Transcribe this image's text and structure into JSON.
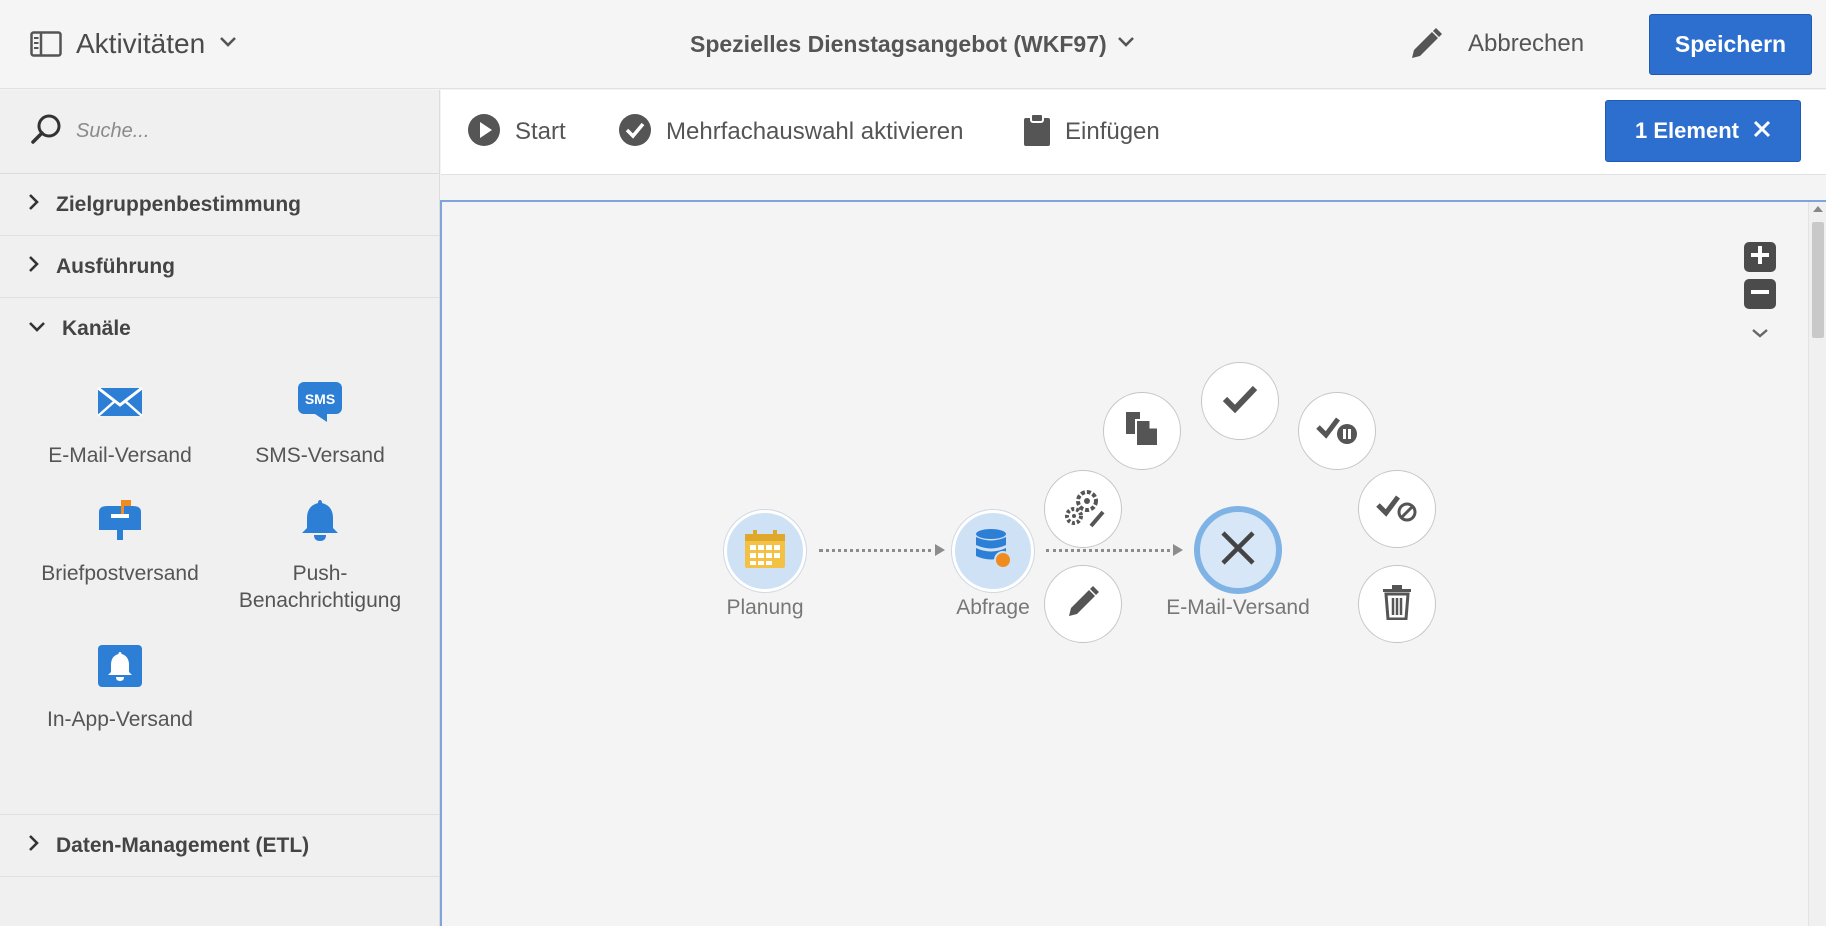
{
  "header": {
    "activities_label": "Aktivitäten",
    "workflow_title": "Spezielles Dienstagsangebot (WKF97)",
    "cancel_label": "Abbrechen",
    "save_label": "Speichern",
    "accent_color": "#2d6fcf"
  },
  "sidebar": {
    "search_placeholder": "Suche...",
    "sections": [
      {
        "label": "Zielgruppenbestimmung",
        "expanded": false
      },
      {
        "label": "Ausführung",
        "expanded": false
      },
      {
        "label": "Kanäle",
        "expanded": true
      },
      {
        "label": "Daten-Management (ETL)",
        "expanded": false
      }
    ],
    "channels": [
      {
        "label": "E-Mail-Versand",
        "icon": "envelope-icon"
      },
      {
        "label": "SMS-Versand",
        "icon": "sms-icon"
      },
      {
        "label": "Briefpostversand",
        "icon": "mailbox-icon"
      },
      {
        "label": "Push-\nBenachrichtigung",
        "icon": "bell-icon"
      },
      {
        "label": "In-App-Versand",
        "icon": "in-app-bell-icon"
      }
    ]
  },
  "toolbar": {
    "start_label": "Start",
    "multiselect_label": "Mehrfachauswahl aktivieren",
    "paste_label": "Einfügen",
    "selection_label": "1 Element"
  },
  "canvas": {
    "nodes": [
      {
        "label": "Planung",
        "icon": "calendar-icon"
      },
      {
        "label": "Abfrage",
        "icon": "database-icon"
      },
      {
        "label": "E-Mail-Versand",
        "icon": "close-icon",
        "selected": true
      }
    ],
    "context_actions": [
      "copy-icon",
      "confirm-icon",
      "pause-icon",
      "settings-icon",
      "stop-icon",
      "edit-icon",
      "delete-icon"
    ]
  }
}
